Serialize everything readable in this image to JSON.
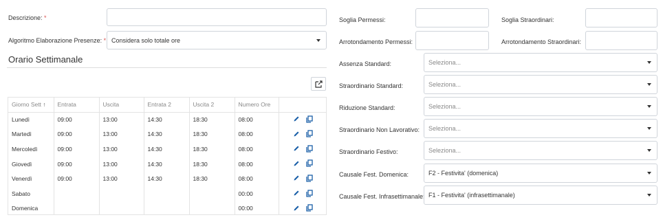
{
  "form": {
    "descrizione_label": "Descrizione:",
    "required_mark": "*",
    "algoritmo_label": "Algoritmo Elaborazione Presenze:",
    "algoritmo_value": "Considera solo totale ore",
    "soglia_permessi_label": "Soglia Permessi:",
    "soglia_straordinari_label": "Soglia Straordinari:",
    "arrotondamento_permessi_label": "Arrotondamento Permessi:",
    "arrotondamento_straordinari_label": "Arrotondamento Straordinari:"
  },
  "orario": {
    "title": "Orario Settimanale",
    "columns": [
      "Giorno Sett",
      "Entrata",
      "Uscita",
      "Entrata 2",
      "Uscita 2",
      "Numero Ore"
    ],
    "sort_indicator": "↑",
    "rows": [
      {
        "giorno": "Lunedì",
        "entrata": "09:00",
        "uscita": "13:00",
        "entrata2": "14:30",
        "uscita2": "18:30",
        "ore": "08:00"
      },
      {
        "giorno": "Martedì",
        "entrata": "09:00",
        "uscita": "13:00",
        "entrata2": "14:30",
        "uscita2": "18:30",
        "ore": "08:00"
      },
      {
        "giorno": "Mercoledì",
        "entrata": "09:00",
        "uscita": "13:00",
        "entrata2": "14:30",
        "uscita2": "18:30",
        "ore": "08:00"
      },
      {
        "giorno": "Giovedì",
        "entrata": "09:00",
        "uscita": "13:00",
        "entrata2": "14:30",
        "uscita2": "18:30",
        "ore": "08:00"
      },
      {
        "giorno": "Venerdì",
        "entrata": "09:00",
        "uscita": "13:00",
        "entrata2": "14:30",
        "uscita2": "18:30",
        "ore": "08:00"
      },
      {
        "giorno": "Sabato",
        "entrata": "",
        "uscita": "",
        "entrata2": "",
        "uscita2": "",
        "ore": "00:00"
      },
      {
        "giorno": "Domenica",
        "entrata": "",
        "uscita": "",
        "entrata2": "",
        "uscita2": "",
        "ore": "00:00"
      }
    ]
  },
  "right": {
    "assenza_label": "Assenza Standard:",
    "straordinario_label": "Straordinario Standard:",
    "riduzione_label": "Riduzione Standard:",
    "straord_non_lav_label": "Straordinario Non Lavorativo:",
    "straord_festivo_label": "Straordinario Festivo:",
    "causale_domenica_label": "Causale Fest. Domenica:",
    "causale_infra_label": "Causale Fest. Infrasettimanale:",
    "placeholder": "Seleziona...",
    "causale_domenica_value": "F2 - Festivita' (domenica)",
    "causale_infra_value": "F1 - Festivita' (infrasettimanale)"
  },
  "icons": {
    "edit": "pencil-icon",
    "copy": "copy-icon",
    "export": "export-icon",
    "caret": "caret-down-icon"
  },
  "colors": {
    "accent": "#1a5fa8",
    "required": "#d9534f",
    "border": "#cfd4da"
  }
}
